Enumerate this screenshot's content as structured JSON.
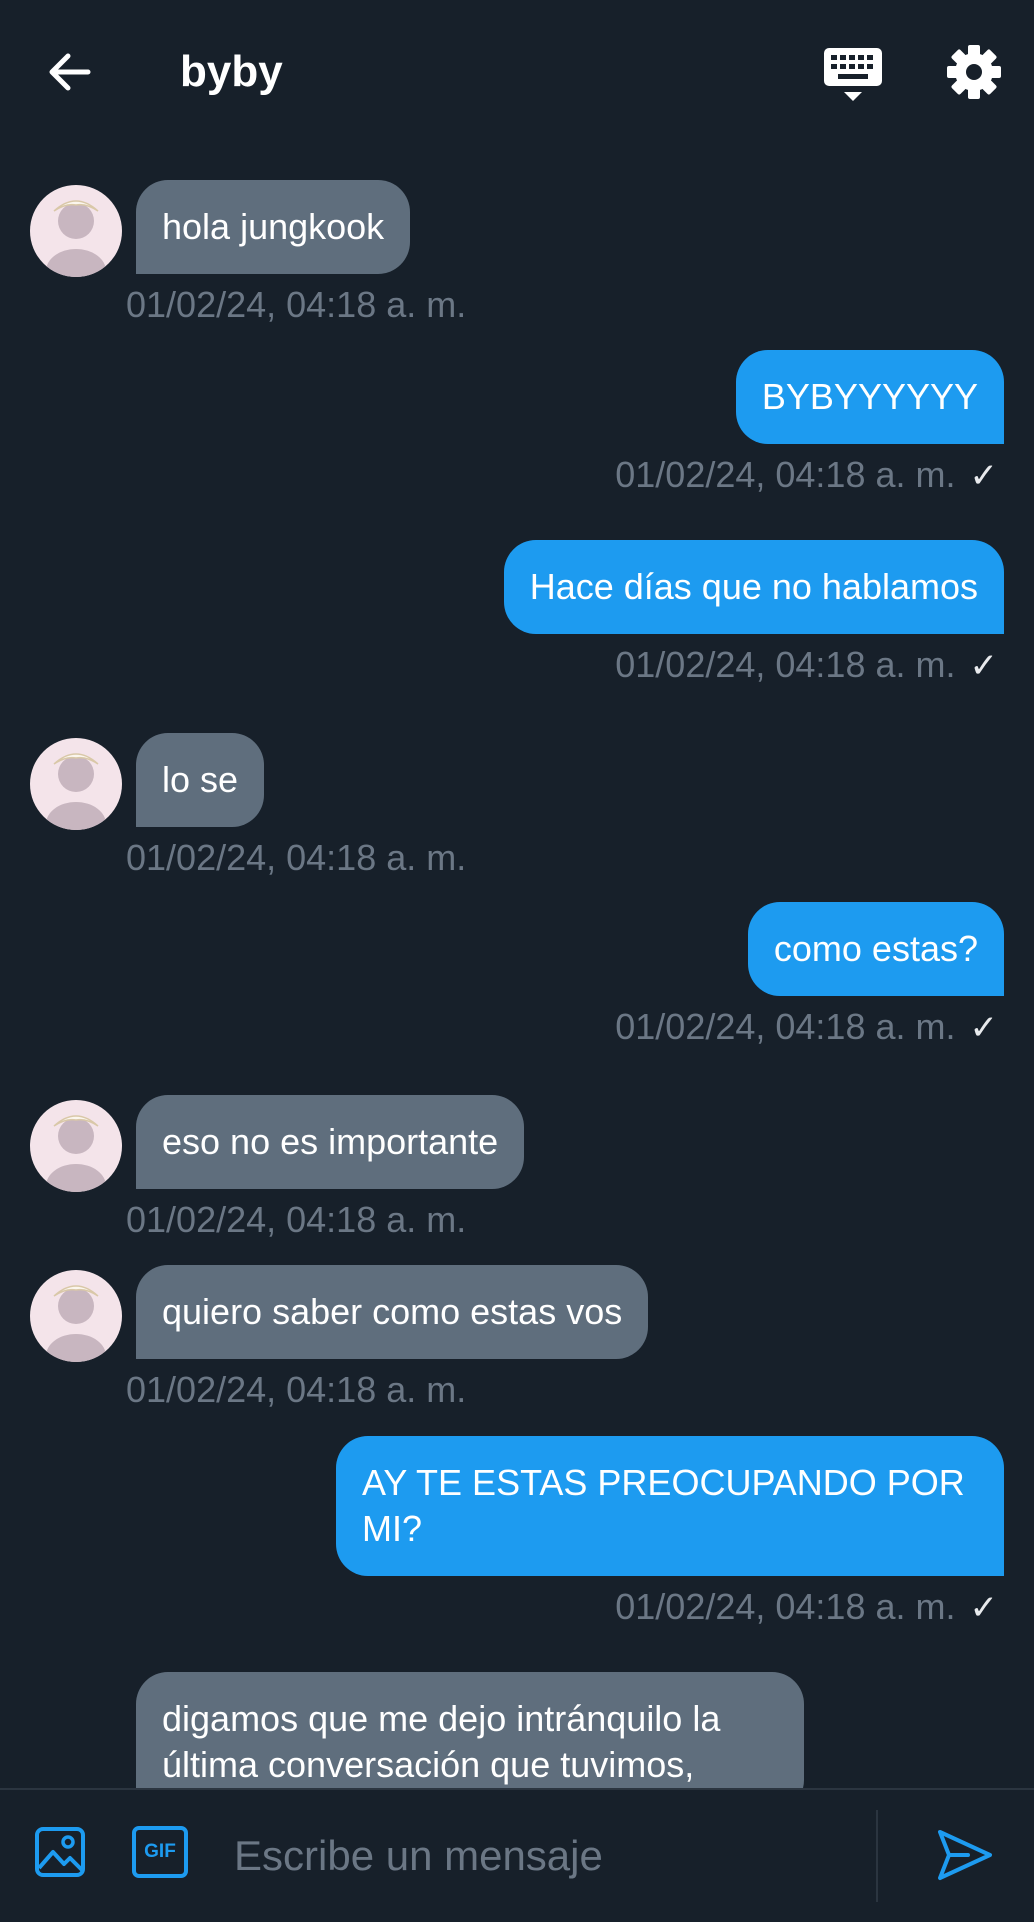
{
  "header": {
    "title": "byby",
    "back_icon": "arrow-left-icon",
    "keyboard_icon": "keyboard-icon",
    "settings_icon": "gear-icon"
  },
  "colors": {
    "background": "#17202a",
    "incoming_bubble": "#5f6e7d",
    "outgoing_bubble": "#1d9bf0",
    "timestamp": "#6b7785",
    "accent": "#1d9bf0"
  },
  "messages": [
    {
      "dir": "in",
      "text": "hola jungkook",
      "time": "01/02/24, 04:18 a. m."
    },
    {
      "dir": "out",
      "text": "BYBYYYYYY",
      "time": "01/02/24, 04:18 a. m.",
      "status": "✓"
    },
    {
      "dir": "out",
      "text": "Hace días que no hablamos",
      "time": "01/02/24, 04:18 a. m.",
      "status": "✓"
    },
    {
      "dir": "in",
      "text": "lo se",
      "time": "01/02/24, 04:18 a. m."
    },
    {
      "dir": "out",
      "text": "como estas?",
      "time": "01/02/24, 04:18 a. m.",
      "status": "✓"
    },
    {
      "dir": "in",
      "text": "eso no es importante",
      "time": "01/02/24, 04:18 a. m."
    },
    {
      "dir": "in",
      "text": "quiero saber como estas vos",
      "time": "01/02/24, 04:18 a. m."
    },
    {
      "dir": "out",
      "line1": "AY TE ESTAS PREOCUPANDO POR",
      "line2": "MI?",
      "time": "01/02/24, 04:18 a. m.",
      "status": "✓"
    },
    {
      "dir": "in",
      "line1": "digamos que me dejo intránquilo la",
      "line2": "última conversación que tuvimos,"
    }
  ],
  "composer": {
    "image_icon": "image-icon",
    "gif_label": "GIF",
    "placeholder": "Escribe un mensaje",
    "value": "",
    "send_icon": "send-icon"
  }
}
